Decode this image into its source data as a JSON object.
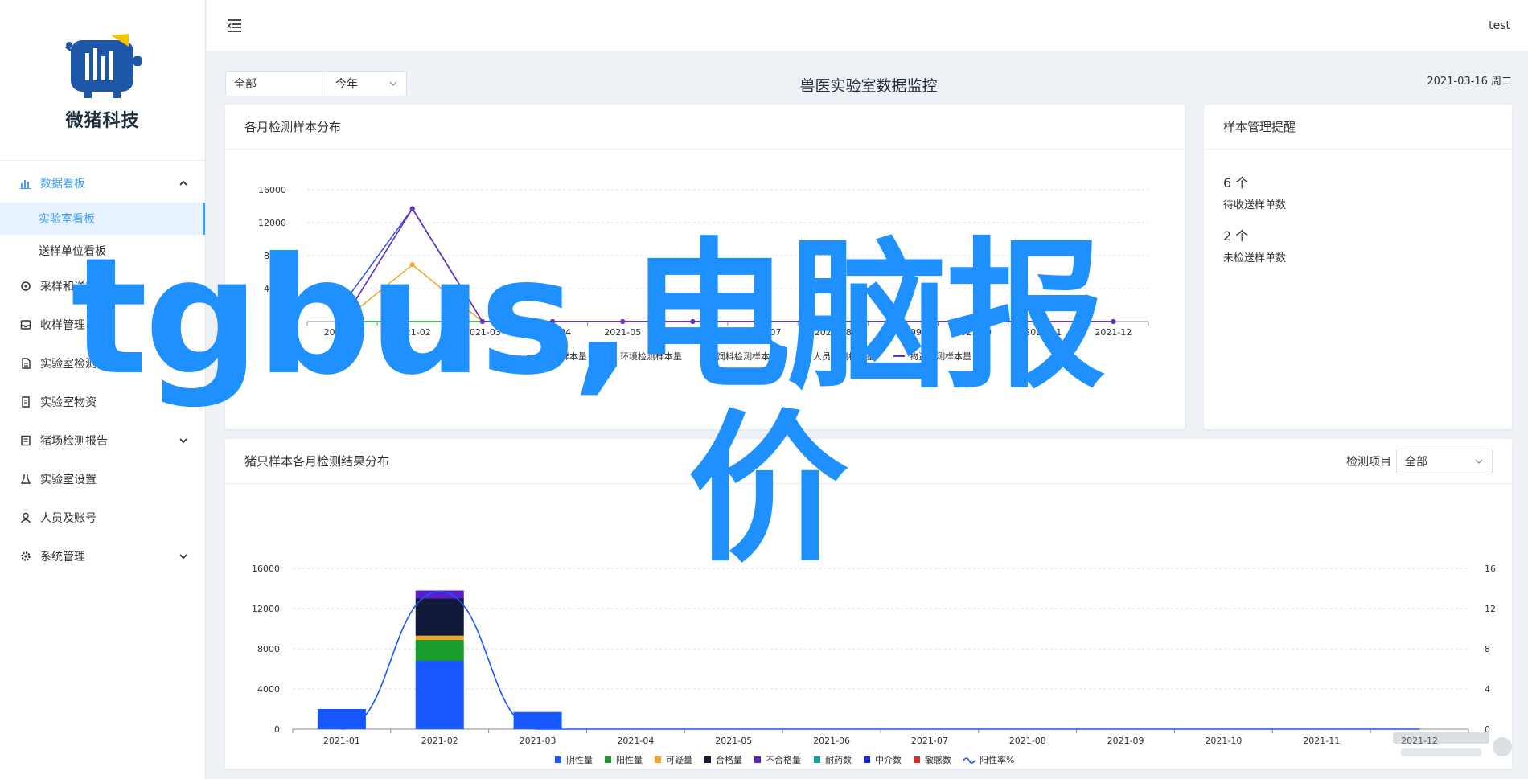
{
  "brand": {
    "name": "微猪科技"
  },
  "topbar": {
    "user": "test"
  },
  "sidebar": {
    "items": [
      {
        "label": "数据看板",
        "icon": "chart-icon",
        "arrow": "up",
        "open": true,
        "children": [
          {
            "label": "实验室看板",
            "active": true
          },
          {
            "label": "送样单位看板",
            "active": false
          }
        ]
      },
      {
        "label": "采样和送样",
        "icon": "sampling-icon",
        "arrow": ""
      },
      {
        "label": "收样管理",
        "icon": "inbox-icon",
        "arrow": ""
      },
      {
        "label": "实验室检测报告",
        "icon": "document-icon",
        "arrow": ""
      },
      {
        "label": "实验室物资",
        "icon": "supplies-icon",
        "arrow": ""
      },
      {
        "label": "猪场检测报告",
        "icon": "report-icon",
        "arrow": "down"
      },
      {
        "label": "实验室设置",
        "icon": "lab-icon",
        "arrow": ""
      },
      {
        "label": "人员及账号",
        "icon": "user-icon",
        "arrow": ""
      },
      {
        "label": "系统管理",
        "icon": "gear-icon",
        "arrow": "down"
      }
    ]
  },
  "filters": {
    "scope": "全部",
    "period": "今年"
  },
  "page": {
    "title": "兽医实验室数据监控",
    "date": "2021-03-16 周二"
  },
  "cards": {
    "monthly": {
      "title": "各月检测样本分布"
    },
    "reminders": {
      "title": "样本管理提醒",
      "items": [
        {
          "value": "6 个",
          "label": "待收送样单数"
        },
        {
          "value": "2 个",
          "label": "未检送样单数"
        }
      ]
    },
    "results": {
      "title": "猪只样本各月检测结果分布",
      "filter_label": "检测项目",
      "filter_value": "全部"
    }
  },
  "chart_data": [
    {
      "type": "line",
      "title": "各月检测样本分布",
      "categories": [
        "2021-01",
        "2021-02",
        "2021-03",
        "2021-04",
        "2021-05",
        "2021-06",
        "2021-07",
        "2021-08",
        "2021-09",
        "2021-10",
        "2021-11",
        "2021-12"
      ],
      "ylim": [
        0,
        16000
      ],
      "yticks": [
        4000,
        8000,
        12000,
        16000
      ],
      "grid": true,
      "legend_position": "bottom",
      "series": [
        {
          "name": "猪只样本量",
          "color": "#2f54eb",
          "values": [
            2000,
            13700,
            0,
            0,
            0,
            0,
            0,
            0,
            0,
            0,
            0,
            0
          ]
        },
        {
          "name": "环境检测样本量",
          "color": "#1a9b2e",
          "values": [
            0,
            0,
            0,
            0,
            0,
            0,
            0,
            0,
            0,
            0,
            0,
            0
          ]
        },
        {
          "name": "饲料检测样本量",
          "color": "#f5a623",
          "values": [
            0,
            6900,
            0,
            0,
            0,
            0,
            0,
            0,
            0,
            0,
            0,
            0
          ]
        },
        {
          "name": "人员检测样本量",
          "color": "#1b2740",
          "values": [
            0,
            13700,
            0,
            0,
            0,
            0,
            0,
            0,
            0,
            0,
            0,
            0
          ]
        },
        {
          "name": "物资检测样本量",
          "color": "#6a2fd0",
          "values": [
            0,
            13700,
            0,
            0,
            0,
            0,
            0,
            0,
            0,
            0,
            0,
            0
          ]
        }
      ]
    },
    {
      "type": "bar",
      "title": "猪只样本各月检测结果分布",
      "categories": [
        "2021-01",
        "2021-02",
        "2021-03",
        "2021-04",
        "2021-05",
        "2021-06",
        "2021-07",
        "2021-08",
        "2021-09",
        "2021-10",
        "2021-11",
        "2021-12"
      ],
      "ylim": [
        0,
        16000
      ],
      "yticks": [
        0,
        4000,
        8000,
        12000,
        16000
      ],
      "y2lim": [
        0,
        16
      ],
      "y2ticks": [
        0,
        4,
        8,
        12,
        16
      ],
      "grid": true,
      "legend_position": "bottom",
      "stacked": true,
      "series": [
        {
          "name": "阴性量",
          "color": "#1757ff",
          "values": [
            2000,
            6800,
            1700,
            0,
            0,
            0,
            0,
            0,
            0,
            0,
            0,
            0
          ]
        },
        {
          "name": "阳性量",
          "color": "#1a9b2e",
          "values": [
            0,
            2100,
            0,
            0,
            0,
            0,
            0,
            0,
            0,
            0,
            0,
            0
          ]
        },
        {
          "name": "可疑量",
          "color": "#f5a623",
          "values": [
            0,
            400,
            0,
            0,
            0,
            0,
            0,
            0,
            0,
            0,
            0,
            0
          ]
        },
        {
          "name": "合格量",
          "color": "#111a3a",
          "values": [
            0,
            3700,
            0,
            0,
            0,
            0,
            0,
            0,
            0,
            0,
            0,
            0
          ]
        },
        {
          "name": "不合格量",
          "color": "#5b1fc9",
          "values": [
            0,
            800,
            0,
            0,
            0,
            0,
            0,
            0,
            0,
            0,
            0,
            0
          ]
        },
        {
          "name": "耐药数",
          "color": "#14a5a5",
          "values": [
            0,
            0,
            0,
            0,
            0,
            0,
            0,
            0,
            0,
            0,
            0,
            0
          ]
        },
        {
          "name": "中介数",
          "color": "#1d2bd6",
          "values": [
            0,
            0,
            0,
            0,
            0,
            0,
            0,
            0,
            0,
            0,
            0,
            0
          ]
        },
        {
          "name": "敏感数",
          "color": "#d32f2f",
          "values": [
            0,
            0,
            0,
            0,
            0,
            0,
            0,
            0,
            0,
            0,
            0,
            0
          ]
        }
      ],
      "line_series": {
        "name": "阳性率%",
        "color": "#1757ff",
        "axis": "right",
        "values": [
          0,
          13.7,
          0,
          0,
          0,
          0,
          0,
          0,
          0,
          0,
          0,
          0
        ]
      }
    }
  ],
  "overlay": {
    "text1": "tgbus,电脑报",
    "text2": "价"
  },
  "colors": {
    "accent": "#409eff",
    "watermark": "#1e90ff"
  }
}
